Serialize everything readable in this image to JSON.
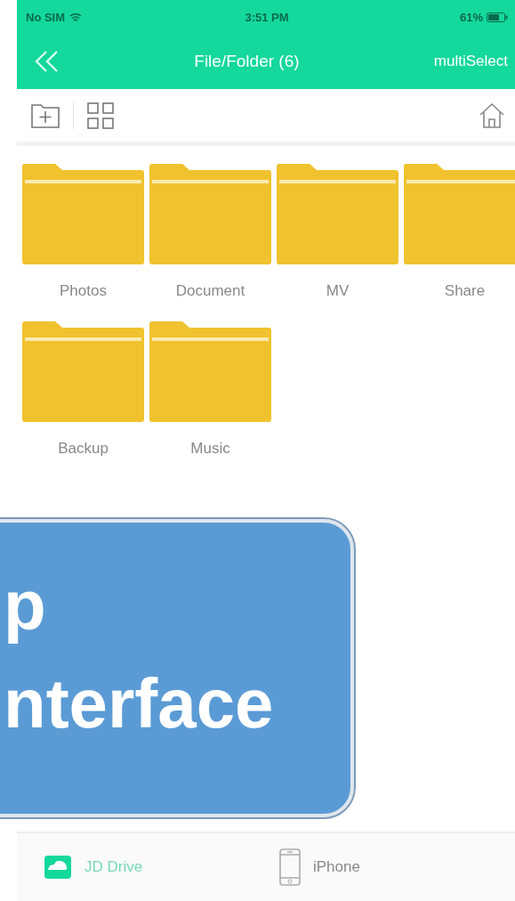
{
  "status_bar": {
    "carrier": "No SIM",
    "time": "3:51 PM",
    "battery": "61%"
  },
  "nav_bar": {
    "title": "File/Folder (6)",
    "action": "multiSelect"
  },
  "folders": [
    {
      "name": "Photos"
    },
    {
      "name": "Document"
    },
    {
      "name": "MV"
    },
    {
      "name": "Share"
    },
    {
      "name": "Backup"
    },
    {
      "name": "Music"
    }
  ],
  "callout": {
    "lines": [
      "p",
      "nterface"
    ]
  },
  "tab_bar": [
    {
      "label": "JD Drive",
      "kind": "drive",
      "selected": true
    },
    {
      "label": "iPhone",
      "kind": "phone",
      "selected": false
    }
  ]
}
